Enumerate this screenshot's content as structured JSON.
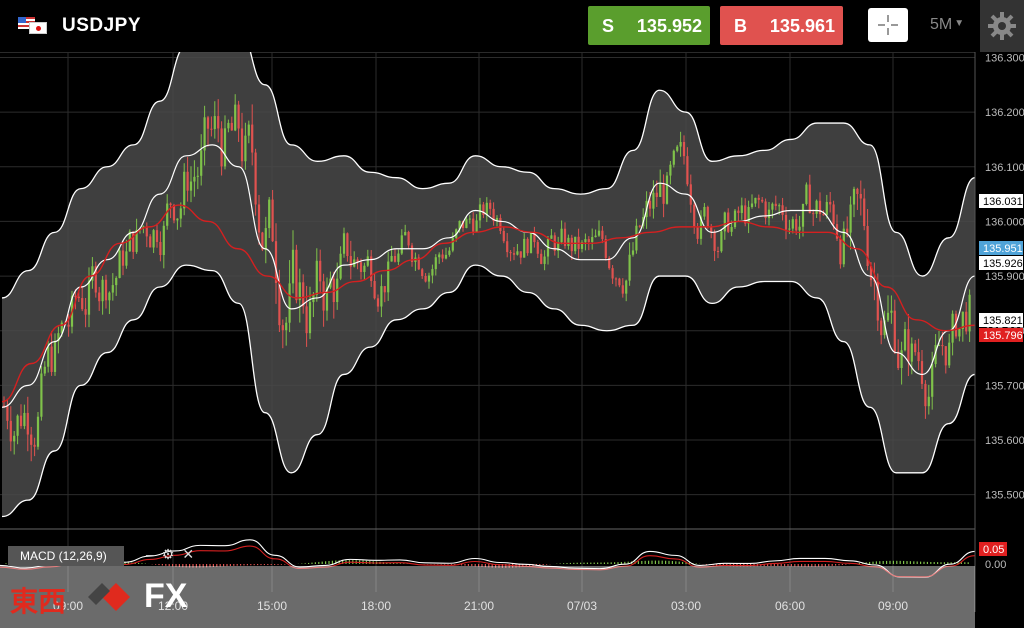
{
  "header": {
    "symbol": "USDJPY",
    "sell": {
      "label": "S",
      "price": "135.952"
    },
    "buy": {
      "label": "B",
      "price": "135.961"
    },
    "timeframe": "5M"
  },
  "axis": {
    "price_ticks": [
      "136.300",
      "136.200",
      "136.100",
      "136.000",
      "135.900",
      "135.800",
      "135.700",
      "135.600",
      "135.500"
    ],
    "time_ticks": [
      "09:00",
      "12:00",
      "15:00",
      "18:00",
      "21:00",
      "07/03",
      "03:00",
      "06:00",
      "09:00"
    ],
    "macd_ticks": [
      "0.00"
    ]
  },
  "price_tags": [
    {
      "text": "136.031",
      "style": "white"
    },
    {
      "text": "135.951",
      "style": "blue"
    },
    {
      "text": "135.926",
      "style": "white"
    },
    {
      "text": "135.821",
      "style": "white"
    },
    {
      "text": "135.796",
      "style": "red"
    },
    {
      "text": "0.05",
      "style": "red"
    }
  ],
  "indicator": {
    "label": "MACD (12,26,9)"
  },
  "logo": {
    "kanji": "東西",
    "fx": "FX"
  },
  "colors": {
    "bull": "#7fc24a",
    "bear": "#e0524f",
    "band": "#4a4a4a",
    "ma": "#d42020",
    "tagBlue": "#4fa3d8",
    "tagRed": "#e02020"
  },
  "chart_data": {
    "type": "candlestick",
    "symbol": "USDJPY",
    "timeframe": "5M",
    "ylim": [
      135.45,
      136.31
    ],
    "series": [
      {
        "name": "Bollinger middle",
        "values": [
          135.66,
          135.7,
          135.78,
          135.88,
          135.93,
          135.98,
          136.05,
          136.12,
          136.14,
          136.1,
          135.95,
          135.84,
          135.86,
          135.92,
          135.93,
          135.95,
          135.95,
          135.97,
          136.02,
          136.0,
          135.98,
          135.95,
          135.93,
          135.93,
          135.97,
          136.07,
          136.05,
          135.98,
          136.0,
          136.01,
          136.02,
          136.02,
          135.98,
          135.9,
          135.76,
          135.72,
          135.8,
          135.9
        ]
      },
      {
        "name": "Moving average",
        "values": [
          135.67,
          135.74,
          135.81,
          135.9,
          135.96,
          135.99,
          136.03,
          136.0,
          135.95,
          135.9,
          135.86,
          135.87,
          135.89,
          135.91,
          135.93,
          135.96,
          135.98,
          135.99,
          135.98,
          135.96,
          135.96,
          135.97,
          135.98,
          135.99,
          135.99,
          136.0,
          135.99,
          135.98,
          135.98,
          135.95,
          135.88,
          135.82,
          135.8,
          135.81
        ]
      }
    ]
  }
}
